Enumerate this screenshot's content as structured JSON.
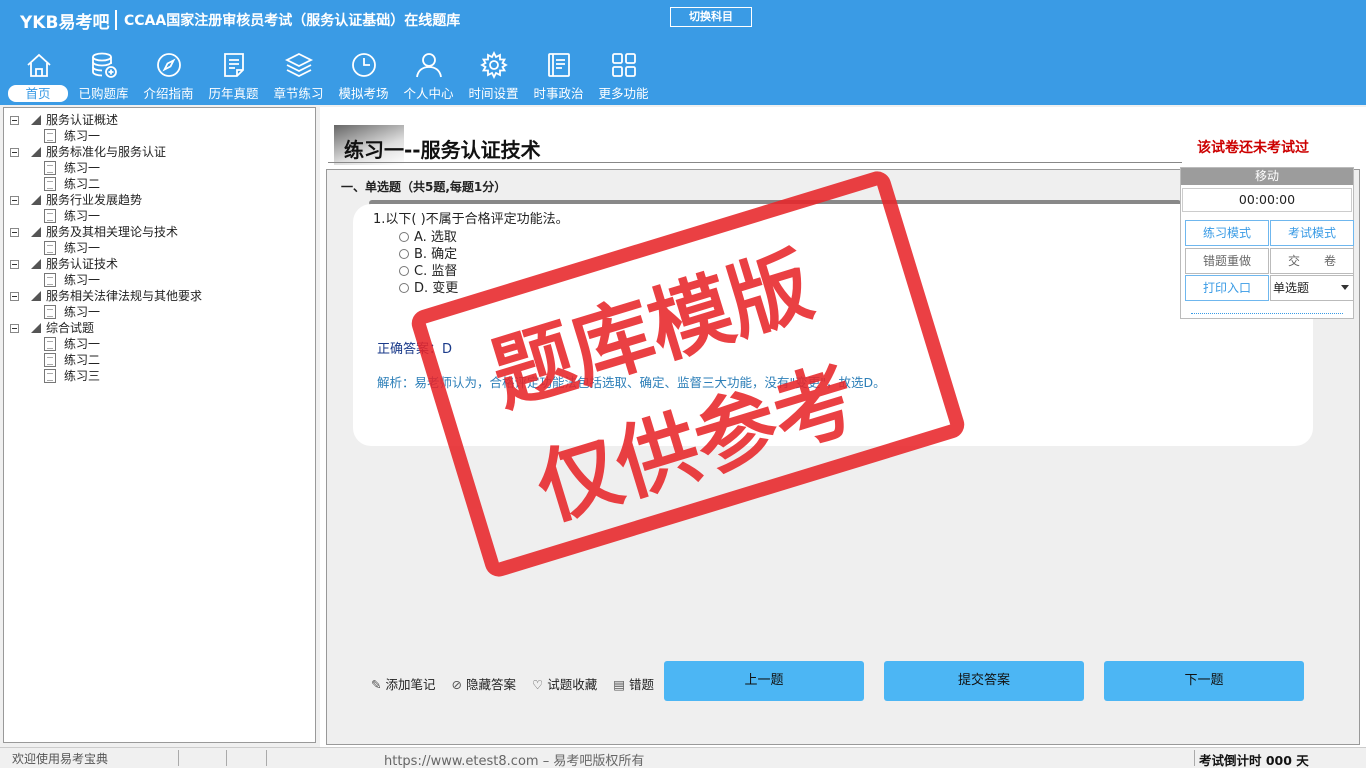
{
  "header": {
    "brand": "YKB易考吧",
    "title": "CCAA国家注册审核员考试（服务认证基础）在线题库",
    "switch_label": "切换科目",
    "nav": [
      {
        "label": "首页",
        "icon": "home-icon"
      },
      {
        "label": "已购题库",
        "icon": "database-icon"
      },
      {
        "label": "介绍指南",
        "icon": "compass-icon"
      },
      {
        "label": "历年真题",
        "icon": "document-list-icon"
      },
      {
        "label": "章节练习",
        "icon": "layers-icon"
      },
      {
        "label": "模拟考场",
        "icon": "clock-icon"
      },
      {
        "label": "个人中心",
        "icon": "user-icon"
      },
      {
        "label": "时间设置",
        "icon": "gear-icon"
      },
      {
        "label": "时事政治",
        "icon": "notebook-icon"
      },
      {
        "label": "更多功能",
        "icon": "grid-icon"
      }
    ]
  },
  "tree": [
    {
      "label": "服务认证概述",
      "children": [
        "练习一"
      ]
    },
    {
      "label": "服务标准化与服务认证",
      "children": [
        "练习一",
        "练习二"
      ]
    },
    {
      "label": "服务行业发展趋势",
      "children": [
        "练习一"
      ]
    },
    {
      "label": "服务及其相关理论与技术",
      "children": [
        "练习一"
      ]
    },
    {
      "label": "服务认证技术",
      "children": [
        "练习一"
      ]
    },
    {
      "label": "服务相关法律法规与其他要求",
      "children": [
        "练习一"
      ]
    },
    {
      "label": "综合试题",
      "children": [
        "练习一",
        "练习二",
        "练习三"
      ]
    }
  ],
  "main": {
    "paper_title": "练习一--服务认证技术",
    "exam_status": "该试卷还未考试过",
    "section_head": "一、单选题（共5题,每题1分）",
    "question": {
      "stem": "1.以下( )不属于合格评定功能法。",
      "options": [
        "A. 选取",
        "B. 确定",
        "C. 监督",
        "D. 变更"
      ],
      "answer": "正确答案：D",
      "analysis": "解析：易老师认为，合格评定功能法包括选取、确定、监督三大功能，没有\"变更\"，故选D。"
    },
    "tools": [
      "添加笔记",
      "隐藏答案",
      "试题收藏",
      "错题"
    ],
    "buttons": {
      "prev": "上一题",
      "submit": "提交答案",
      "next": "下一题"
    }
  },
  "side_panel": {
    "move": "移动",
    "timer": "00:00:00",
    "practice_mode": "练习模式",
    "exam_mode": "考试模式",
    "retry_wrong": "错题重做",
    "hand_in": "交　　卷",
    "print": "打印入口",
    "type_select": "单选题"
  },
  "watermark": {
    "line1": "题库模版",
    "line2": "仅供参考"
  },
  "statusbar": {
    "welcome": "欢迎使用易考宝典",
    "copyright": "https://www.etest8.com – 易考吧版权所有",
    "countdown": "考试倒计时 000 天"
  },
  "colors": {
    "header_bg": "#3a9be5",
    "button_blue": "#4cb6f4",
    "stamp_red": "#e8262a",
    "status_red": "#cc0000"
  }
}
